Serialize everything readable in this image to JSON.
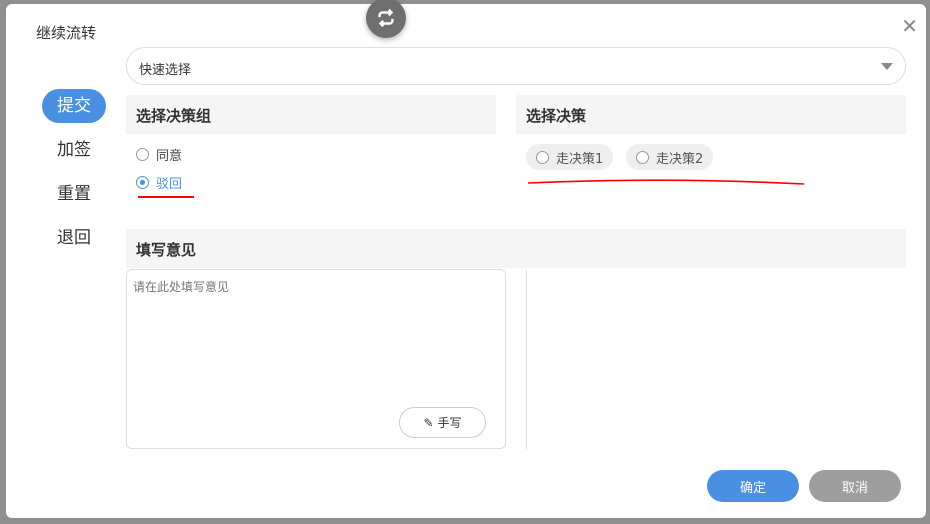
{
  "dialog": {
    "title": "继续流转"
  },
  "nav": [
    "提交",
    "加签",
    "重置",
    "退回"
  ],
  "quick_select": {
    "value": "快速选择"
  },
  "group_section": {
    "title": "选择决策组",
    "options": [
      "同意",
      "驳回"
    ],
    "selected": "驳回"
  },
  "decision_section": {
    "title": "选择决策",
    "options": [
      "走决策1",
      "走决策2"
    ]
  },
  "opinion_section": {
    "title": "填写意见",
    "placeholder": "请在此处填写意见",
    "handwrite_label": "手写"
  },
  "footer": {
    "confirm": "确定",
    "cancel": "取消"
  },
  "colors": {
    "accent": "#4a90e2",
    "cancel": "#9e9e9e",
    "annotation": "#ff0000"
  }
}
